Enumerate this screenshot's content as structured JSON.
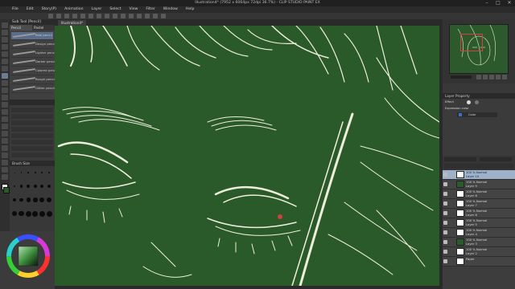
{
  "window": {
    "title": "Illustration4* (7952 x 6064px 72dpi 36.7%) - CLIP STUDIO PAINT EX",
    "controls": [
      "–",
      "□",
      "✕"
    ]
  },
  "menu": [
    "File",
    "Edit",
    "Story(P)",
    "Animation",
    "Layer",
    "Select",
    "View",
    "Filter",
    "Window",
    "Help"
  ],
  "subtool": {
    "header": "Sub Tool [Pencil]",
    "tabs": [
      "Pencil",
      "Pastel"
    ],
    "brushes": [
      "Real pencil",
      "Design pencil",
      "Lighter pencil",
      "Darker pencil",
      "Colored pencil",
      "Rough pencil",
      "Glitter pencil"
    ]
  },
  "brush_size": {
    "header": "Brush Size",
    "sizes": [
      "0.7",
      "1",
      "1.5",
      "2",
      "2.5",
      "3",
      "4",
      "5",
      "6",
      "7",
      "8",
      "10",
      "12",
      "15",
      "17",
      "20",
      "25",
      "30",
      "40",
      "50",
      "60",
      "70",
      "80",
      "100"
    ]
  },
  "canvas": {
    "tab": "Illustration4*",
    "background": "#2b5a2a",
    "line_color": "#f1f1e6"
  },
  "navigator": {
    "zoom": "36.7"
  },
  "layer_property": {
    "header": "Layer Property",
    "effect": "Effect",
    "expression_label": "Expression color",
    "expression_value": "Color"
  },
  "layers": [
    {
      "name": "100 % Normal\nLayer 10",
      "thumb": "#ffffff",
      "selected": true
    },
    {
      "name": "100 % Normal\nLayer 9",
      "thumb": "#2d5a2c",
      "selected": false
    },
    {
      "name": "100 % Normal\nLayer 8",
      "thumb": "#ffffff",
      "selected": false
    },
    {
      "name": "100 % Normal\nLayer 7",
      "thumb": "#ffffff",
      "selected": false
    },
    {
      "name": "100 % Normal\nLayer 6",
      "thumb": "#ffffff",
      "selected": false
    },
    {
      "name": "100 % Normal\nLayer 5",
      "thumb": "#ffffff",
      "selected": false
    },
    {
      "name": "100 % Normal\nLayer 4",
      "thumb": "#ffffff",
      "selected": false
    },
    {
      "name": "100 % Normal\nLayer 3",
      "thumb": "#2d5a2c",
      "selected": false
    },
    {
      "name": "100 % Normal\nLayer 2",
      "thumb": "#ffffff",
      "selected": false
    },
    {
      "name": "Paper",
      "thumb": "#ffffff",
      "selected": false
    }
  ]
}
